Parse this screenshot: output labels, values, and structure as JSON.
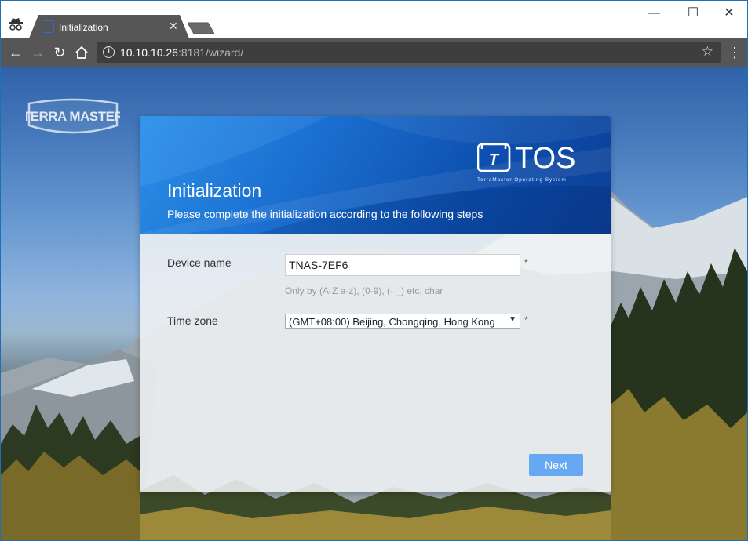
{
  "browser": {
    "tab_title": "Initialization",
    "url_host": "10.10.10.26",
    "url_rest": ":8181/wizard/",
    "icons": {
      "incognito": "incognito-icon",
      "back": "back-arrow-icon",
      "forward": "forward-arrow-icon",
      "reload": "reload-icon",
      "home": "home-icon",
      "info": "info-icon",
      "star": "star-icon",
      "menu": "three-dots-menu-icon"
    },
    "window_controls": {
      "minimize": "—",
      "maximize": "☐",
      "close": "✕"
    }
  },
  "page": {
    "brand_logo_text": "TERRA MASTER",
    "tos_logo": {
      "mark": "T",
      "name": "TOS",
      "tagline": "TerraMaster Operating System"
    },
    "header": {
      "title": "Initialization",
      "subtitle": "Please complete the initialization according to the following steps"
    },
    "form": {
      "device_name": {
        "label": "Device name",
        "value": "TNAS-7EF6",
        "required_mark": "*",
        "hint": "Only by (A-Z a-z), (0-9), (- _) etc. char"
      },
      "time_zone": {
        "label": "Time zone",
        "selected": "(GMT+08:00) Beijing, Chongqing, Hong Kong",
        "required_mark": "*"
      }
    },
    "next_label": "Next"
  },
  "colors": {
    "toolbar": "#565656",
    "header_gradient_start": "#2a8fe8",
    "header_gradient_end": "#0b3f96",
    "next_button": "#66a9f2"
  }
}
